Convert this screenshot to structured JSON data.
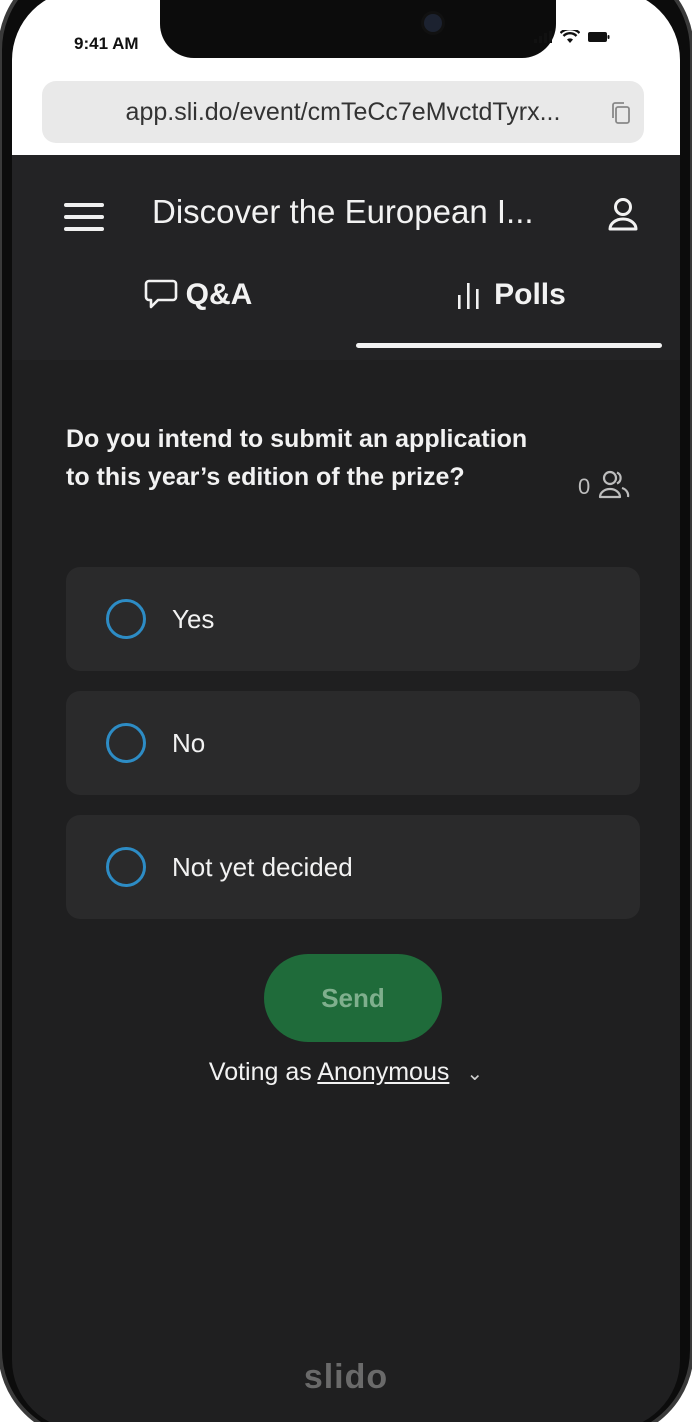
{
  "status": {
    "time": "9:41 AM"
  },
  "browser": {
    "url": "app.sli.do/event/cmTeCc7eMvctdTyrx..."
  },
  "header": {
    "title": "Discover the European I..."
  },
  "tabs": [
    {
      "label": "Q&A",
      "icon": "chat-bubble-icon",
      "active": false
    },
    {
      "label": "Polls",
      "icon": "bar-chart-icon",
      "active": true
    }
  ],
  "poll": {
    "question": "Do you intend to submit an application to this year’s edition of the prize?",
    "participant_count": "0",
    "options": [
      {
        "label": "Yes"
      },
      {
        "label": "No"
      },
      {
        "label": "Not yet decided"
      }
    ],
    "send_label": "Send",
    "voting_prefix": "Voting as",
    "voting_name": "Anonymous"
  },
  "footer": {
    "brand": "slido"
  },
  "colors": {
    "background": "#1f1f20",
    "radio_border": "#2d8cc5",
    "send_button": "#1f6b3a"
  }
}
